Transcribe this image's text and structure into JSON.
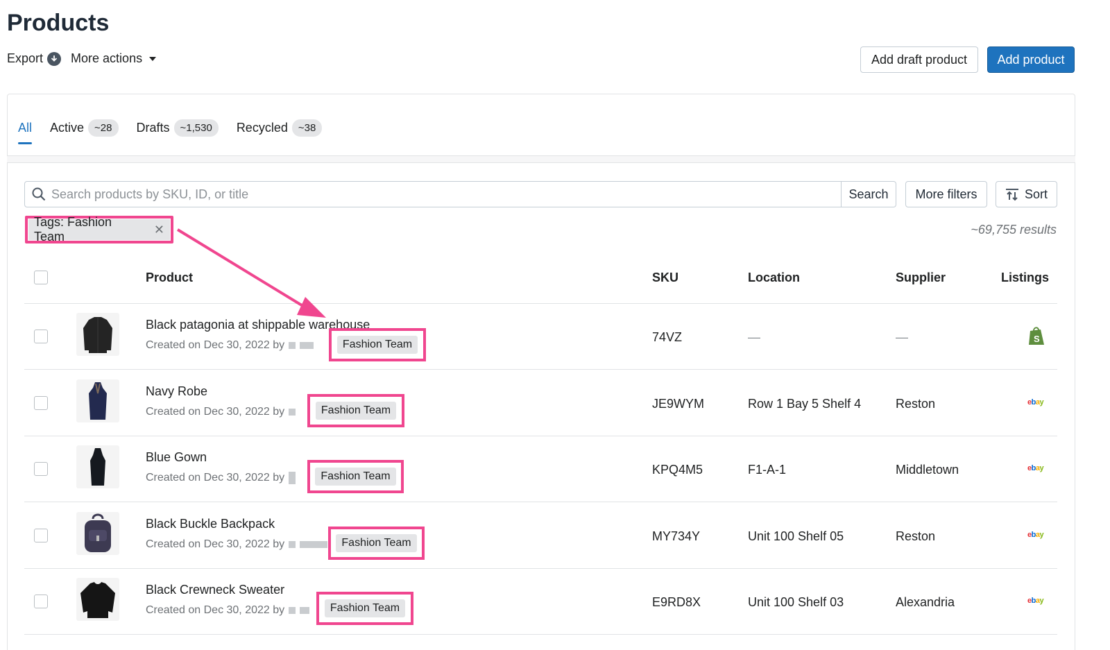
{
  "header": {
    "title": "Products",
    "export_label": "Export",
    "more_actions_label": "More actions",
    "add_draft_label": "Add draft product",
    "add_product_label": "Add product"
  },
  "tabs": [
    {
      "label": "All",
      "count": ""
    },
    {
      "label": "Active",
      "count": "~28"
    },
    {
      "label": "Drafts",
      "count": "~1,530"
    },
    {
      "label": "Recycled",
      "count": "~38"
    }
  ],
  "search": {
    "placeholder": "Search products by SKU, ID, or title",
    "search_label": "Search",
    "more_filters_label": "More filters",
    "sort_label": "Sort"
  },
  "filter": {
    "chip_label": "Tags: Fashion Team",
    "results": "~69,755 results"
  },
  "table": {
    "columns": [
      "Product",
      "SKU",
      "Location",
      "Supplier",
      "Listings"
    ],
    "rows": [
      {
        "name": "Black patagonia at shippable warehouse",
        "created": "Created on Dec 30, 2022 by",
        "tag": "Fashion Team",
        "sku": "74VZ",
        "location": "—",
        "supplier": "—",
        "listing": "shopify-icon"
      },
      {
        "name": "Navy Robe",
        "created": "Created on Dec 30, 2022 by",
        "tag": "Fashion Team",
        "sku": "JE9WYM",
        "location": "Row 1 Bay 5 Shelf 4",
        "supplier": "Reston",
        "listing": "ebay-icon"
      },
      {
        "name": "Blue Gown",
        "created": "Created on Dec 30, 2022 by",
        "tag": "Fashion Team",
        "sku": "KPQ4M5",
        "location": "F1-A-1",
        "supplier": "Middletown",
        "listing": "ebay-icon"
      },
      {
        "name": "Black Buckle Backpack",
        "created": "Created on Dec 30, 2022 by",
        "tag": "Fashion Team",
        "sku": "MY734Y",
        "location": "Unit 100 Shelf 05",
        "supplier": "Reston",
        "listing": "ebay-icon"
      },
      {
        "name": "Black Crewneck Sweater",
        "created": "Created on Dec 30, 2022 by",
        "tag": "Fashion Team",
        "sku": "E9RD8X",
        "location": "Unit 100 Shelf 03",
        "supplier": "Alexandria",
        "listing": "ebay-icon"
      }
    ]
  },
  "ebay_logo": {
    "e": "e",
    "b": "b",
    "a": "a",
    "y": "y"
  },
  "colors": {
    "accent": "#1e73be",
    "highlight": "#f0468f",
    "tag_bg": "#e4e5e7"
  }
}
